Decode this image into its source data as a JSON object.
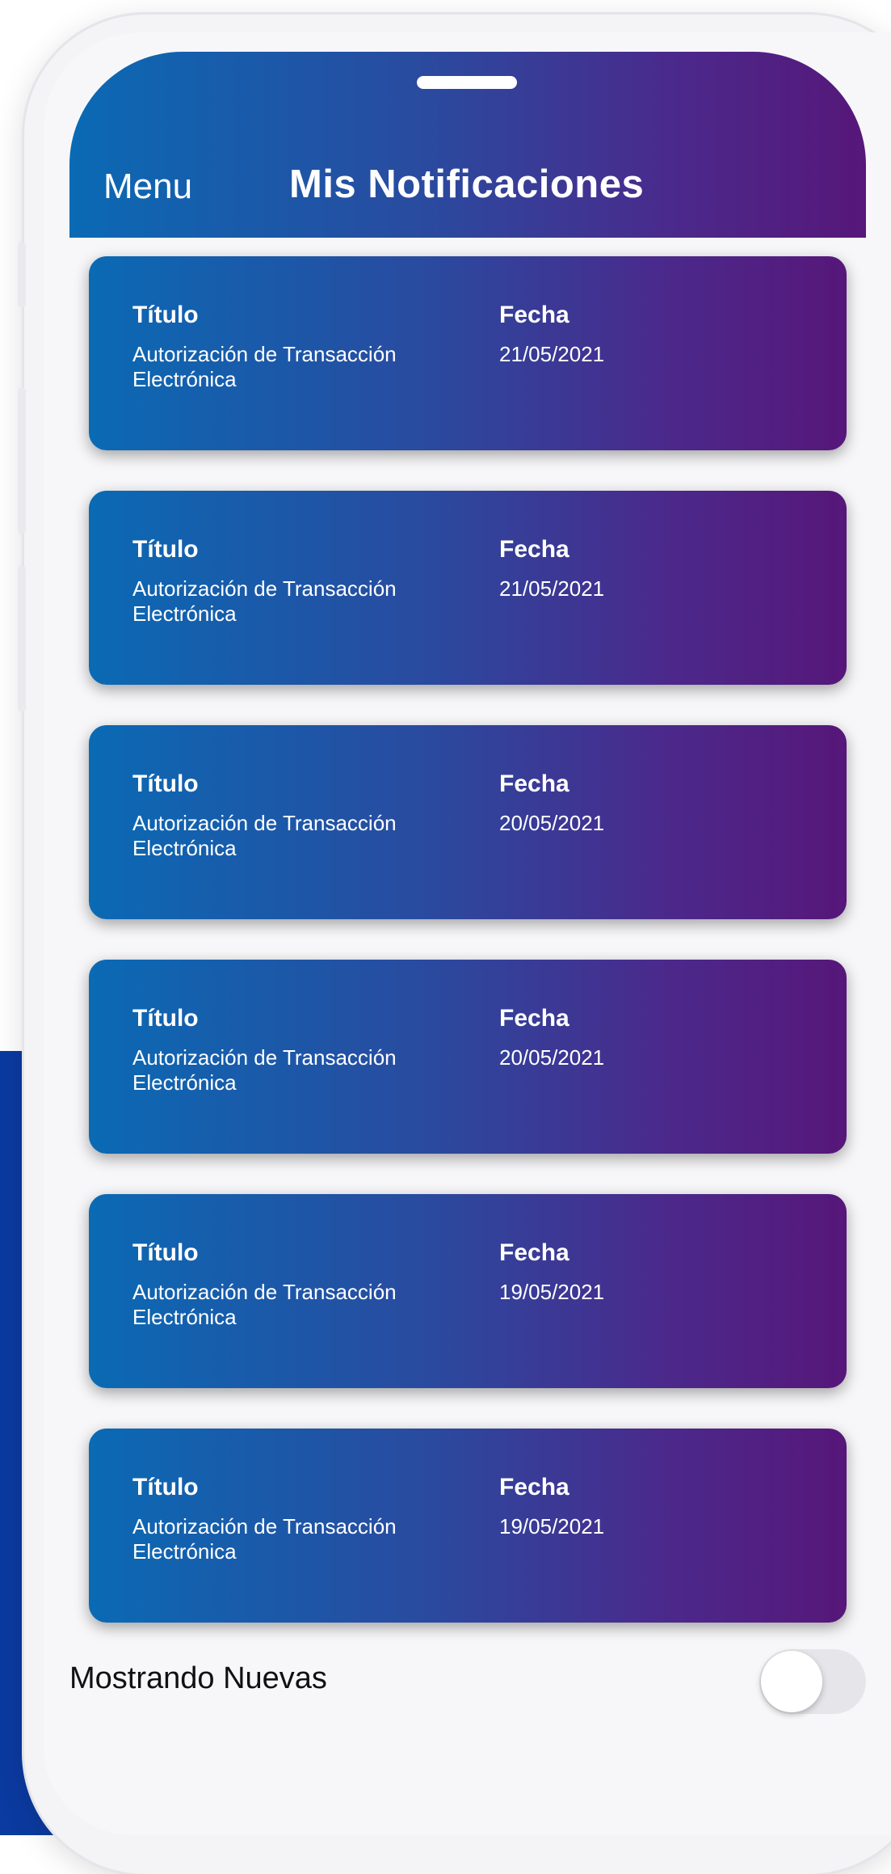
{
  "header": {
    "menu_label": "Menu",
    "title": "Mis Notificaciones"
  },
  "labels": {
    "title_label": "Título",
    "date_label": "Fecha"
  },
  "notifications": [
    {
      "title": "Autorización de Transacción Electrónica",
      "date": "21/05/2021"
    },
    {
      "title": "Autorización de Transacción Electrónica",
      "date": "21/05/2021"
    },
    {
      "title": "Autorización de Transacción Electrónica",
      "date": "20/05/2021"
    },
    {
      "title": "Autorización de Transacción Electrónica",
      "date": "20/05/2021"
    },
    {
      "title": "Autorización de Transacción Electrónica",
      "date": "19/05/2021"
    },
    {
      "title": "Autorización de Transacción Electrónica",
      "date": "19/05/2021"
    }
  ],
  "footer": {
    "filter_label": "Mostrando Nuevas",
    "toggle_on": false
  },
  "colors": {
    "gradient_start": "#0a6ab4",
    "gradient_end": "#561779",
    "background_accent": "#0b3aa0"
  }
}
